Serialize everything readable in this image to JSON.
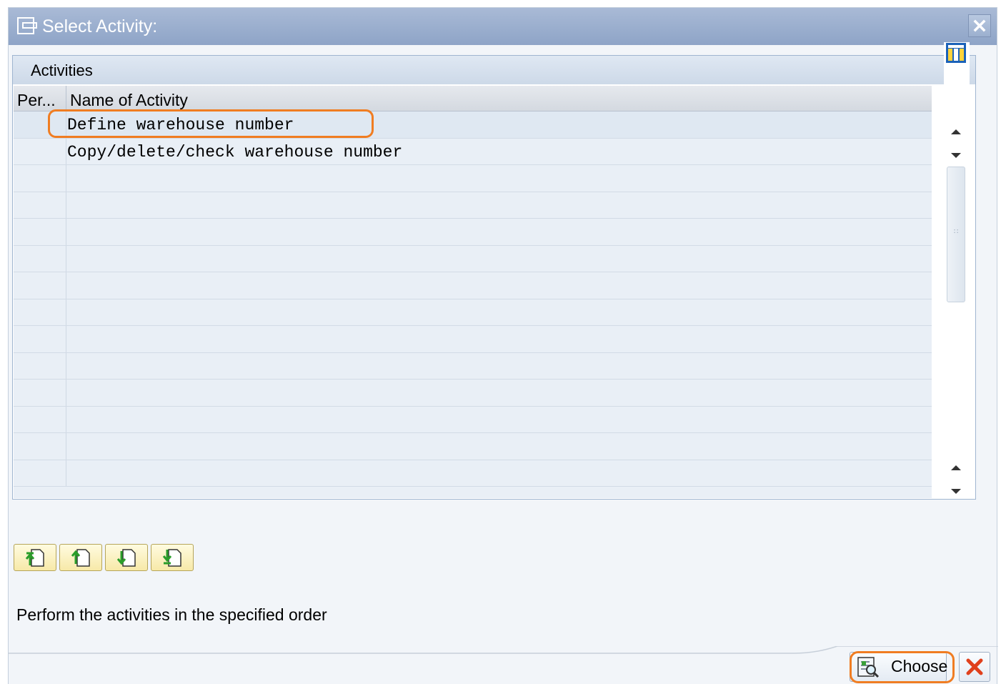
{
  "dialog": {
    "title": "Select Activity:",
    "group_title": "Activities",
    "columns": [
      "Per...",
      "Name of Activity"
    ],
    "rows": [
      {
        "per": "",
        "name": "Define warehouse number"
      },
      {
        "per": "",
        "name": "Copy/delete/check warehouse number"
      },
      {
        "per": "",
        "name": ""
      },
      {
        "per": "",
        "name": ""
      },
      {
        "per": "",
        "name": ""
      },
      {
        "per": "",
        "name": ""
      },
      {
        "per": "",
        "name": ""
      },
      {
        "per": "",
        "name": ""
      },
      {
        "per": "",
        "name": ""
      },
      {
        "per": "",
        "name": ""
      },
      {
        "per": "",
        "name": ""
      },
      {
        "per": "",
        "name": ""
      },
      {
        "per": "",
        "name": ""
      },
      {
        "per": "",
        "name": ""
      }
    ],
    "instruction": "Perform the activities in the specified order",
    "choose_label": "Choose",
    "nav_buttons": [
      "first-page-icon",
      "previous-page-icon",
      "next-page-icon",
      "last-page-icon"
    ],
    "icons": {
      "title": "window-icon",
      "close": "close-icon",
      "column_settings": "column-settings-icon",
      "choose": "choose-icon",
      "cancel": "cancel-icon"
    },
    "colors": {
      "titlebar": "#8ea4c7",
      "highlight": "#f07d22",
      "cancel_x": "#e0401c"
    }
  }
}
